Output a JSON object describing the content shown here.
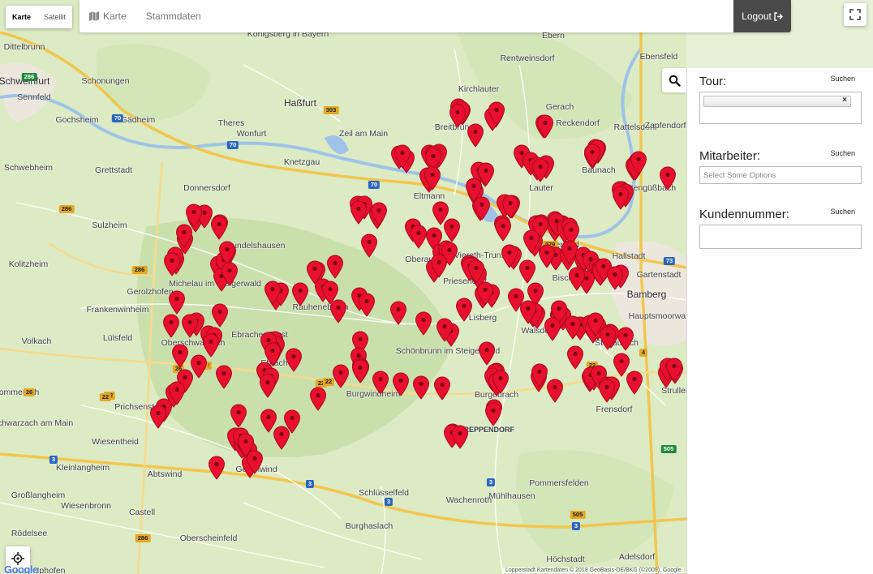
{
  "map": {
    "type_toggle": {
      "karte": "Karte",
      "satellit": "Satellit",
      "active": "karte"
    },
    "logo": "Google",
    "attribution": "Lopperstadt  Kartendaten © 2018 GeoBasis-DE/BKG (©2009), Google",
    "places": [
      {
        "label": "Dittelbrunn",
        "cls": ""
      },
      {
        "label": "Schweinfurt",
        "cls": "city"
      },
      {
        "label": "Sennfeld",
        "cls": ""
      },
      {
        "label": "Schonungen",
        "cls": ""
      },
      {
        "label": "Gochsheim",
        "cls": ""
      },
      {
        "label": "Gädheim",
        "cls": ""
      },
      {
        "label": "Haßfurt",
        "cls": "city"
      },
      {
        "label": "Theres",
        "cls": ""
      },
      {
        "label": "Wonfurt",
        "cls": ""
      },
      {
        "label": "Zeil am Main",
        "cls": ""
      },
      {
        "label": "Knetzgau",
        "cls": ""
      },
      {
        "label": "Königsberg in Bayern",
        "cls": ""
      },
      {
        "label": "Ebern",
        "cls": ""
      },
      {
        "label": "Rentweinsdorf",
        "cls": ""
      },
      {
        "label": "Kirchlauter",
        "cls": ""
      },
      {
        "label": "Gerach",
        "cls": ""
      },
      {
        "label": "Reckendorf",
        "cls": ""
      },
      {
        "label": "Rattelsdorf",
        "cls": ""
      },
      {
        "label": "Zapfendorf",
        "cls": ""
      },
      {
        "label": "Ebensfeld",
        "cls": ""
      },
      {
        "label": "Breitbrunn",
        "cls": ""
      },
      {
        "label": "Schwebheim",
        "cls": ""
      },
      {
        "label": "Grettstadt",
        "cls": ""
      },
      {
        "label": "Donnersdorf",
        "cls": ""
      },
      {
        "label": "Eltmann",
        "cls": ""
      },
      {
        "label": "Lauter",
        "cls": ""
      },
      {
        "label": "Baunach",
        "cls": ""
      },
      {
        "label": "Breitengüßbach",
        "cls": ""
      },
      {
        "label": "Sulzheim",
        "cls": ""
      },
      {
        "label": "Hundelshausen",
        "cls": ""
      },
      {
        "label": "Kolitzheim",
        "cls": ""
      },
      {
        "label": "Gerolzhofen",
        "cls": ""
      },
      {
        "label": "Michelau im Steigerwald",
        "cls": ""
      },
      {
        "label": "Oberaurach",
        "cls": ""
      },
      {
        "label": "Viereth-Trunstadt",
        "cls": ""
      },
      {
        "label": "Oberhaid",
        "cls": ""
      },
      {
        "label": "Hallstadt",
        "cls": ""
      },
      {
        "label": "Gartenstadt",
        "cls": ""
      },
      {
        "label": "Bamberg",
        "cls": "city"
      },
      {
        "label": "Frankenwinheim",
        "cls": ""
      },
      {
        "label": "Rauhenebrach",
        "cls": ""
      },
      {
        "label": "Priesendorf",
        "cls": ""
      },
      {
        "label": "Bischberg",
        "cls": ""
      },
      {
        "label": "Lülsfeld",
        "cls": ""
      },
      {
        "label": "Ebracher Forst",
        "cls": ""
      },
      {
        "label": "Lisberg",
        "cls": ""
      },
      {
        "label": "Walsdorf",
        "cls": ""
      },
      {
        "label": "Stegaurach",
        "cls": ""
      },
      {
        "label": "Hauptsmoorwald",
        "cls": ""
      },
      {
        "label": "Volkach",
        "cls": ""
      },
      {
        "label": "Oberschwarzach",
        "cls": ""
      },
      {
        "label": "Ebrach",
        "cls": ""
      },
      {
        "label": "Schönbrunn im Steigerwald",
        "cls": ""
      },
      {
        "label": "Burgwindheim",
        "cls": ""
      },
      {
        "label": "Burgebrach",
        "cls": ""
      },
      {
        "label": "Frensdorf",
        "cls": ""
      },
      {
        "label": "Strullendorf",
        "cls": ""
      },
      {
        "label": "Prichsenstadt",
        "cls": ""
      },
      {
        "label": "Sommerach",
        "cls": ""
      },
      {
        "label": "Schwarzach am Main",
        "cls": ""
      },
      {
        "label": "Wiesentheid",
        "cls": ""
      },
      {
        "label": "TREPPENDORF",
        "cls": "small"
      },
      {
        "label": "Kleinlangheim",
        "cls": ""
      },
      {
        "label": "Abtswind",
        "cls": ""
      },
      {
        "label": "Geiselwind",
        "cls": ""
      },
      {
        "label": "Großlangheim",
        "cls": ""
      },
      {
        "label": "Schlüsselfeld",
        "cls": ""
      },
      {
        "label": "Wachenroth",
        "cls": ""
      },
      {
        "label": "Mühlhausen",
        "cls": ""
      },
      {
        "label": "Pommersfelden",
        "cls": ""
      },
      {
        "label": "Wiesenbronn",
        "cls": ""
      },
      {
        "label": "Castell",
        "cls": ""
      },
      {
        "label": "Burghaslach",
        "cls": ""
      },
      {
        "label": "Rödelsee",
        "cls": ""
      },
      {
        "label": "Iphofen",
        "cls": ""
      },
      {
        "label": "Oberscheinfeld",
        "cls": ""
      },
      {
        "label": "Höchstadt",
        "cls": ""
      },
      {
        "label": "Adelsdorf",
        "cls": ""
      }
    ],
    "shields": [
      {
        "label": "70",
        "cls": "a"
      },
      {
        "label": "70",
        "cls": "a"
      },
      {
        "label": "70",
        "cls": "a"
      },
      {
        "label": "73",
        "cls": "a"
      },
      {
        "label": "3",
        "cls": "a"
      },
      {
        "label": "3",
        "cls": "a"
      },
      {
        "label": "3",
        "cls": "a"
      },
      {
        "label": "3",
        "cls": "a"
      },
      {
        "label": "3",
        "cls": "a"
      },
      {
        "label": "286",
        "cls": "c"
      },
      {
        "label": "286",
        "cls": "b"
      },
      {
        "label": "286",
        "cls": "b"
      },
      {
        "label": "286",
        "cls": "b"
      },
      {
        "label": "22",
        "cls": "b"
      },
      {
        "label": "22",
        "cls": "b"
      },
      {
        "label": "22",
        "cls": "b"
      },
      {
        "label": "22",
        "cls": "b"
      },
      {
        "label": "22",
        "cls": "b"
      },
      {
        "label": "22",
        "cls": "b"
      },
      {
        "label": "22",
        "cls": "b"
      },
      {
        "label": "26",
        "cls": "b"
      },
      {
        "label": "26",
        "cls": "b"
      },
      {
        "label": "279",
        "cls": "b"
      },
      {
        "label": "303",
        "cls": "b"
      },
      {
        "label": "505",
        "cls": "c"
      },
      {
        "label": "505",
        "cls": "b"
      },
      {
        "label": "4",
        "cls": "b"
      }
    ],
    "marker_count": 270
  },
  "nav": {
    "map_label": "Karte",
    "master_label": "Stammdaten",
    "logout_label": "Logout"
  },
  "panel": {
    "tour": {
      "label": "Tour:",
      "search": "Suchen",
      "chip_remove": "×"
    },
    "mitarbeiter": {
      "label": "Mitarbeiter:",
      "search": "Suchen",
      "placeholder": "Select Some Options"
    },
    "kundennummer": {
      "label": "Kundennummer:",
      "search": "Suchen",
      "value": ""
    }
  }
}
